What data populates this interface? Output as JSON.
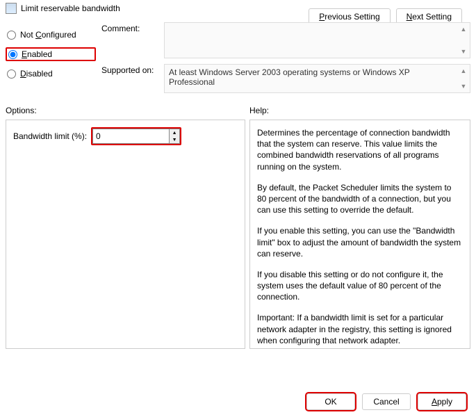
{
  "title": "Limit reservable bandwidth",
  "nav": {
    "prev": "Previous Setting",
    "next": "Next Setting"
  },
  "state": {
    "not_configured": "Not Configured",
    "enabled": "Enabled",
    "disabled": "Disabled",
    "selected": "enabled"
  },
  "meta": {
    "comment_label": "Comment:",
    "comment_value": "",
    "supported_label": "Supported on:",
    "supported_value": "At least Windows Server 2003 operating systems or Windows XP Professional"
  },
  "sections": {
    "options_label": "Options:",
    "help_label": "Help:"
  },
  "options": {
    "bandwidth_label": "Bandwidth limit (%):",
    "bandwidth_value": "0"
  },
  "help": {
    "p1": "Determines the percentage of connection bandwidth that the system can reserve. This value limits the combined bandwidth reservations of all programs running on the system.",
    "p2": "By default, the Packet Scheduler limits the system to 80 percent of the bandwidth of a connection, but you can use this setting to override the default.",
    "p3": "If you enable this setting, you can use the \"Bandwidth limit\" box to adjust the amount of bandwidth the system can reserve.",
    "p4": "If you disable this setting or do not configure it, the system uses the default value of 80 percent of the connection.",
    "p5": "Important: If a bandwidth limit is set for a particular network adapter in the registry, this setting is ignored when configuring that network adapter."
  },
  "footer": {
    "ok": "OK",
    "cancel": "Cancel",
    "apply": "Apply"
  }
}
